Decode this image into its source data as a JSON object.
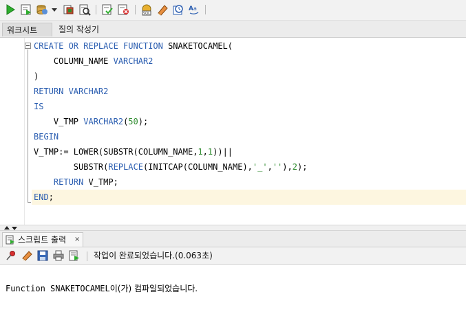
{
  "worksheet_tabs": [
    {
      "label": "워크시트",
      "active": true
    },
    {
      "label": "질의 작성기",
      "active": false
    }
  ],
  "code_lines": [
    {
      "indent": "",
      "tokens": [
        {
          "t": "CREATE OR REPLACE FUNCTION",
          "k": "kw"
        },
        {
          "t": " SNAKETOCAMEL(",
          "k": ""
        }
      ]
    },
    {
      "indent": "    ",
      "tokens": [
        {
          "t": "COLUMN_NAME ",
          "k": ""
        },
        {
          "t": "VARCHAR2",
          "k": "kw"
        }
      ]
    },
    {
      "indent": "",
      "tokens": [
        {
          "t": ")",
          "k": ""
        }
      ]
    },
    {
      "indent": "",
      "tokens": [
        {
          "t": "RETURN VARCHAR2",
          "k": "kw"
        }
      ]
    },
    {
      "indent": "",
      "tokens": [
        {
          "t": "IS",
          "k": "kw"
        }
      ]
    },
    {
      "indent": "    ",
      "tokens": [
        {
          "t": "V_TMP ",
          "k": ""
        },
        {
          "t": "VARCHAR2",
          "k": "kw"
        },
        {
          "t": "(",
          "k": ""
        },
        {
          "t": "50",
          "k": "num"
        },
        {
          "t": ");",
          "k": ""
        }
      ]
    },
    {
      "indent": "",
      "tokens": [
        {
          "t": "BEGIN",
          "k": "kw"
        }
      ]
    },
    {
      "indent": "",
      "tokens": [
        {
          "t": "V_TMP:= LOWER(SUBSTR(COLUMN_NAME,",
          "k": ""
        },
        {
          "t": "1",
          "k": "num"
        },
        {
          "t": ",",
          "k": ""
        },
        {
          "t": "1",
          "k": "num"
        },
        {
          "t": "))||",
          "k": ""
        }
      ]
    },
    {
      "indent": "        ",
      "tokens": [
        {
          "t": "SUBSTR(",
          "k": ""
        },
        {
          "t": "REPLACE",
          "k": "kw"
        },
        {
          "t": "(INITCAP(COLUMN_NAME),",
          "k": ""
        },
        {
          "t": "'_'",
          "k": "str"
        },
        {
          "t": ",",
          "k": ""
        },
        {
          "t": "''",
          "k": "str"
        },
        {
          "t": "),",
          "k": ""
        },
        {
          "t": "2",
          "k": "num"
        },
        {
          "t": ");",
          "k": ""
        }
      ]
    },
    {
      "indent": "    ",
      "tokens": [
        {
          "t": "RETURN",
          "k": "kw"
        },
        {
          "t": " V_TMP;",
          "k": ""
        }
      ]
    },
    {
      "indent": "",
      "tokens": [
        {
          "t": "END",
          "k": "kw"
        },
        {
          "t": ";",
          "k": ""
        }
      ]
    }
  ],
  "output_panel": {
    "tab_label": "스크립트 출력",
    "tab_close": "×",
    "status": "작업이 완료되었습니다.(0.063초)",
    "message_prefix": "Function SNAKETOCAMEL",
    "message_suffix": "이(가) 컴파일되었습니다."
  },
  "icons": [
    "run-statement-icon",
    "run-script-icon",
    "commit-icon",
    "dropdown-icon",
    "autotrace-icon",
    "explain-plan-icon",
    "commit-check-icon",
    "rollback-icon",
    "sql-tuning-icon",
    "clear-icon",
    "history-icon",
    "format-case-icon"
  ],
  "colors": {
    "keyword": "#2a5db0",
    "number": "#2e8b2e",
    "current_line": "#fdf6e0"
  }
}
